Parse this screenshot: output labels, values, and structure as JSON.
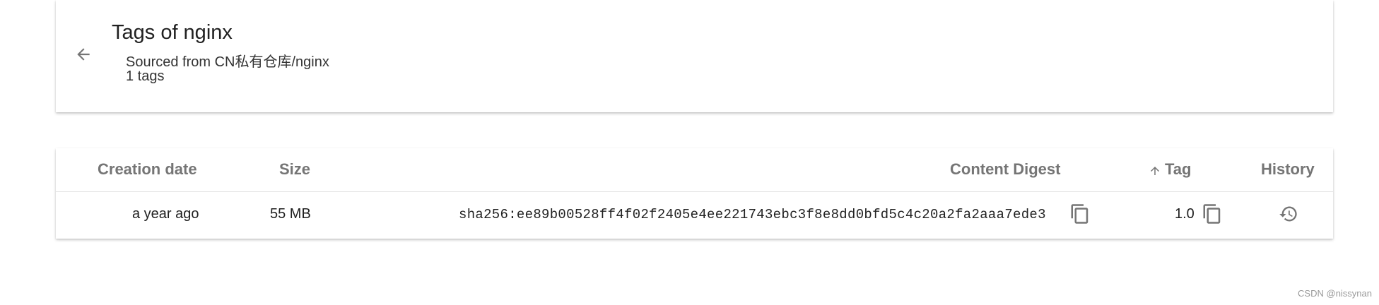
{
  "header": {
    "title": "Tags of nginx",
    "subtitle": "Sourced from CN私有仓库/nginx",
    "count": "1 tags"
  },
  "table": {
    "columns": {
      "creation_date": "Creation date",
      "size": "Size",
      "content_digest": "Content Digest",
      "tag": "Tag",
      "history": "History"
    },
    "sort": {
      "column": "Tag",
      "direction": "ascending",
      "icon": "arrow-upward-icon"
    },
    "rows": [
      {
        "creation_date": "a year ago",
        "size": "55 MB",
        "digest": "sha256:ee89b00528ff4f02f2405e4ee221743ebc3f8e8dd0bfd5c4c20a2fa2aaa7ede3",
        "tag": "1.0"
      }
    ]
  },
  "icons": {
    "back": "arrow-back-icon",
    "copy": "copy-icon",
    "history": "history-icon"
  },
  "watermark": "CSDN @nissynan",
  "colors": {
    "header_text": "#757575",
    "icon": "#757575",
    "text": "#212121"
  }
}
